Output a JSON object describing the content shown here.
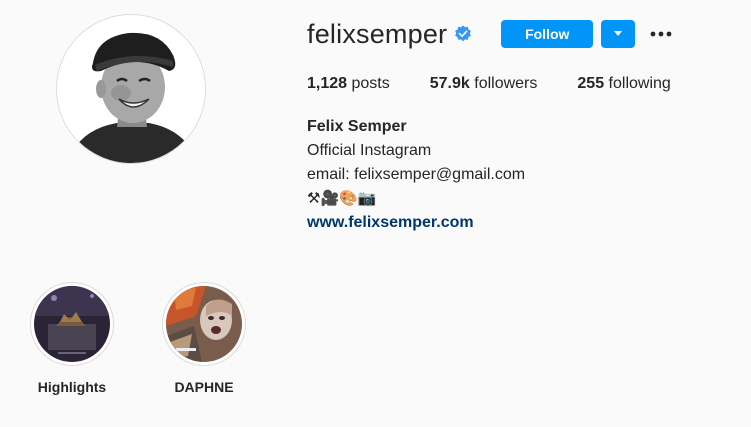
{
  "profile": {
    "username": "felixsemper",
    "verified_icon": "verified-badge-icon",
    "follow_label": "Follow",
    "dropdown_icon": "caret-down-icon",
    "more_icon": "more-options-icon"
  },
  "stats": {
    "posts_count": "1,128",
    "posts_label": "posts",
    "followers_count": "57.9k",
    "followers_label": "followers",
    "following_count": "255",
    "following_label": "following"
  },
  "bio": {
    "full_name": "Felix Semper",
    "line1": "Official Instagram",
    "line2": "email: felixsemper@gmail.com",
    "emojis": "⚒🎥🎨📷",
    "website": "www.felixsemper.com"
  },
  "highlights": [
    {
      "label": "Highlights"
    },
    {
      "label": "DAPHNE"
    }
  ],
  "colors": {
    "accent": "#0095f6",
    "link": "#00376b",
    "verified": "#3897f0",
    "background": "#fafafa"
  }
}
